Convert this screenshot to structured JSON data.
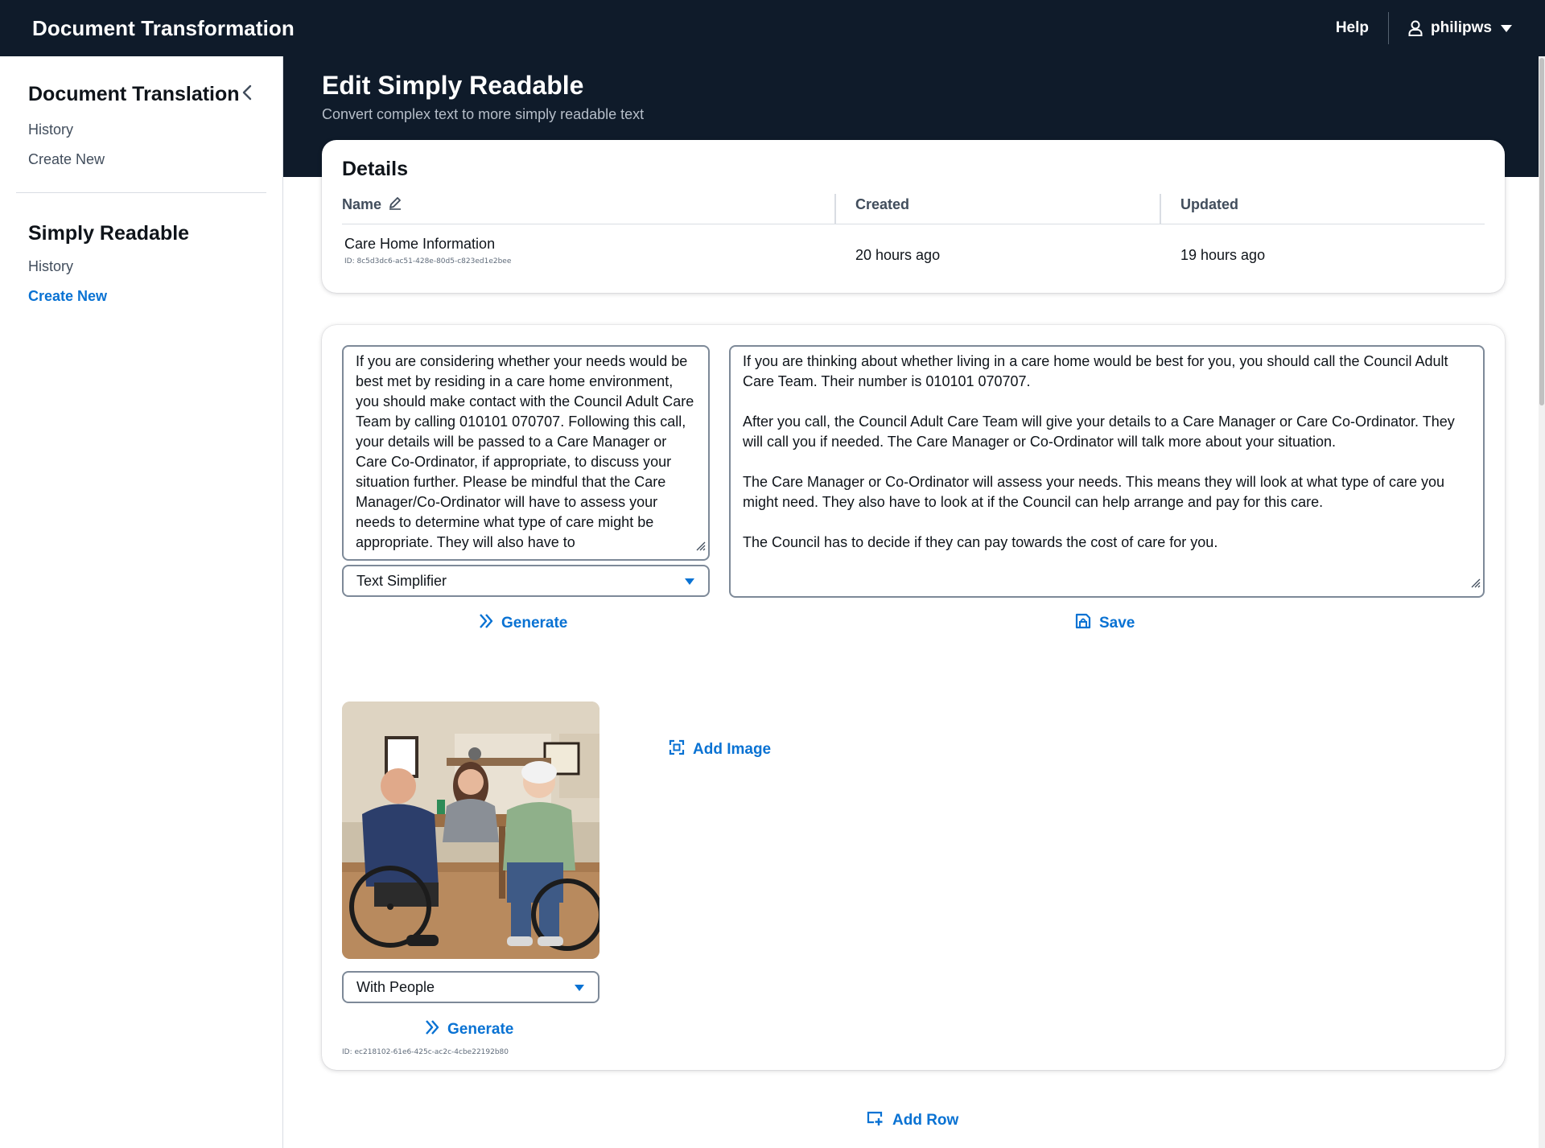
{
  "topbar": {
    "app_title": "Document Transformation",
    "help_label": "Help",
    "username": "philipws",
    "background": "#0f1b2a"
  },
  "sidebar": {
    "sections": [
      {
        "heading": "Document Translation",
        "links": [
          {
            "label": "History",
            "active": false
          },
          {
            "label": "Create New",
            "active": false
          }
        ]
      },
      {
        "heading": "Simply Readable",
        "links": [
          {
            "label": "History",
            "active": false
          },
          {
            "label": "Create New",
            "active": true
          }
        ]
      }
    ]
  },
  "page": {
    "title": "Edit Simply Readable",
    "subtitle": "Convert complex text to more simply readable text"
  },
  "details": {
    "title": "Details",
    "columns": {
      "name": "Name",
      "created": "Created",
      "updated": "Updated"
    },
    "row": {
      "name": "Care Home Information",
      "id": "ID: 8c5d3dc6-ac51-428e-80d5-c823ed1e2bee",
      "created": "20 hours ago",
      "updated": "19 hours ago"
    }
  },
  "content": {
    "source_text": "If you are considering whether your needs would be best met by residing in a care home environment, you should make contact with the Council Adult Care Team by calling 010101 070707. Following this call, your details will be passed to a Care Manager or Care Co-Ordinator, if appropriate, to discuss your situation further.  Please be mindful that the Care Manager/Co-Ordinator will have to assess your needs to determine what type of care might be appropriate.  They will also have to",
    "output_paragraphs": [
      "If you are thinking about whether living in a care home would be best for you, you should call the Council Adult Care Team. Their number is 010101 070707.",
      "After you call, the Council Adult Care Team will give your details to a Care Manager or Care Co-Ordinator. They will call you if needed. The Care Manager or Co-Ordinator will talk more about your situation.",
      "The Care Manager or Co-Ordinator will assess your needs. This means they will look at what type of care you might need. They also have to look at if the Council can help arrange and pay for this care.",
      "The Council has to decide if they can pay towards the cost of care for you."
    ],
    "model_select": "Text Simplifier",
    "generate_label": "Generate",
    "save_label": "Save",
    "add_image_label": "Add Image",
    "image_style_select": "With People",
    "image_generate_label": "Generate",
    "image_id": "ID: ec218102-61e6-425c-ac2c-4cbe22192b80"
  },
  "add_row_label": "Add Row",
  "colors": {
    "accent": "#0972d3",
    "header_bg": "#0f1b2a",
    "border": "#7d8998"
  }
}
